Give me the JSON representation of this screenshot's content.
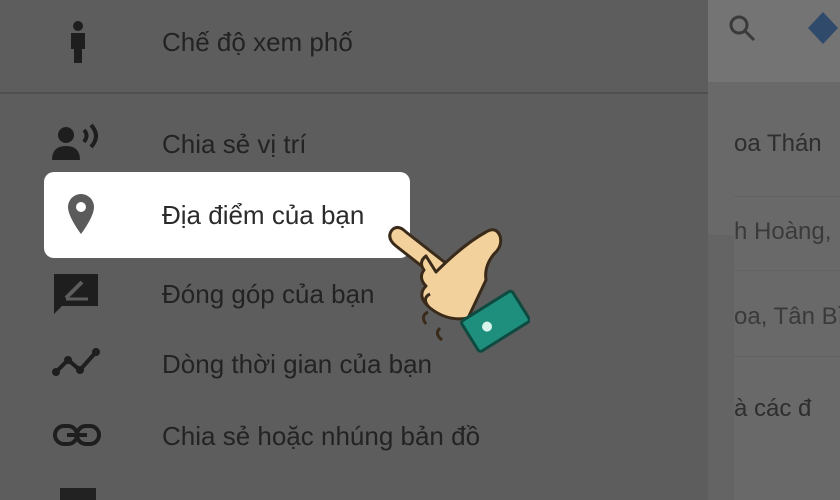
{
  "menu": {
    "street_view": {
      "label": "Chế độ xem phố",
      "icon": "pegman-icon"
    },
    "share_location": {
      "label": "Chia sẻ vị trí",
      "icon": "share-location-icon"
    },
    "your_places": {
      "label": "Địa điểm của bạn",
      "icon": "place-pin-icon"
    },
    "contributions": {
      "label": "Đóng góp của bạn",
      "icon": "contribute-icon"
    },
    "timeline": {
      "label": "Dòng thời gian của bạn",
      "icon": "timeline-icon"
    },
    "share_embed": {
      "label": "Chia sẻ hoặc nhúng bản đồ",
      "icon": "link-icon"
    }
  },
  "map": {
    "snippets": [
      "oa Thán",
      "h Hoàng,",
      "oa, Tân Bì",
      "à các đ"
    ]
  },
  "colors": {
    "highlight": "#ffffff",
    "dim_overlay": "#5d5d5d",
    "cuff": "#1f8f7d"
  }
}
